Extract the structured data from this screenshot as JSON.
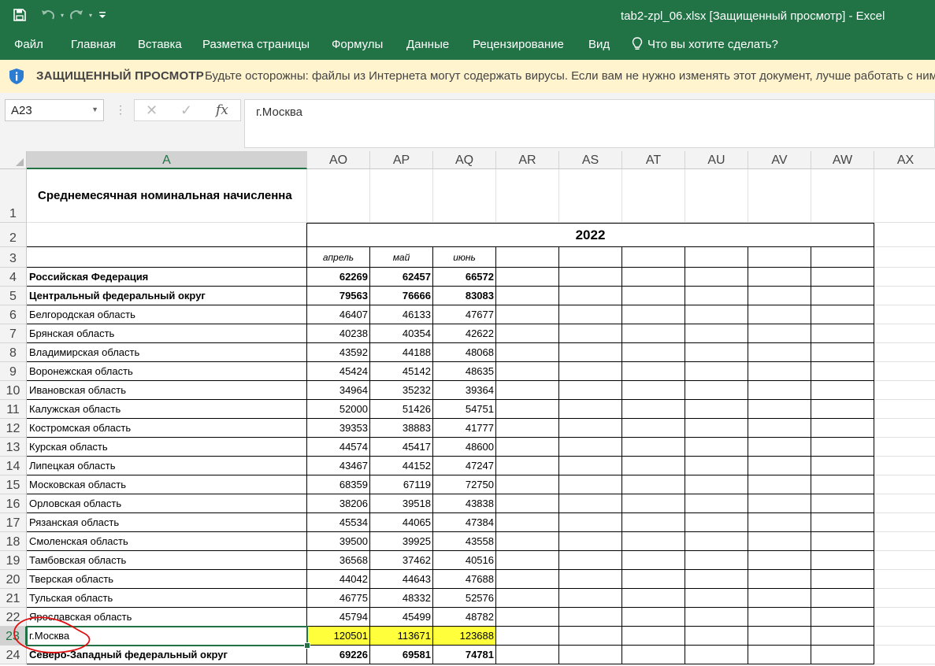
{
  "titlebar": {
    "title": "tab2-zpl_06.xlsx  [Защищенный просмотр] - Excel",
    "icons": [
      "save-icon",
      "undo-icon",
      "redo-icon",
      "customize-qat-icon"
    ]
  },
  "ribbon": {
    "tabs": [
      "Файл",
      "Главная",
      "Вставка",
      "Разметка страницы",
      "Формулы",
      "Данные",
      "Рецензирование",
      "Вид"
    ],
    "tell_me": "Что вы хотите сделать?"
  },
  "protected_view": {
    "title": "ЗАЩИЩЕННЫЙ ПРОСМОТР",
    "message": "Будьте осторожны: файлы из Интернета могут содержать вирусы. Если вам не нужно изменять этот документ, лучше работать с ним"
  },
  "formula_bar": {
    "name_box": "A23",
    "formula": "г.Москва"
  },
  "colors": {
    "accent": "#217346",
    "highlight": "#ffff3c",
    "annotation": "#e01010",
    "warning_bar": "#fff4ce"
  },
  "sheet": {
    "columns": [
      "A",
      "AO",
      "AP",
      "AQ",
      "AR",
      "AS",
      "AT",
      "AU",
      "AV",
      "AW",
      "AX"
    ],
    "row_numbers": [
      "1",
      "2",
      "3",
      "4",
      "5",
      "6",
      "7",
      "8",
      "9",
      "10",
      "11",
      "12",
      "13",
      "14",
      "15",
      "16",
      "17",
      "18",
      "19",
      "20",
      "21",
      "22",
      "23",
      "24"
    ],
    "title": "Среднемесячная номинальная начисленна",
    "year": "2022",
    "months": [
      "апрель",
      "май",
      "июнь"
    ],
    "rows": [
      {
        "name": "Российская Федерация",
        "values": [
          "62269",
          "62457",
          "66572"
        ]
      },
      {
        "name": "Центральный федеральный округ",
        "values": [
          "79563",
          "76666",
          "83083"
        ]
      },
      {
        "name": "Белгородская область",
        "values": [
          "46407",
          "46133",
          "47677"
        ]
      },
      {
        "name": "Брянская область",
        "values": [
          "40238",
          "40354",
          "42622"
        ]
      },
      {
        "name": "Владимирская область",
        "values": [
          "43592",
          "44188",
          "48068"
        ]
      },
      {
        "name": "Воронежская область",
        "values": [
          "45424",
          "45142",
          "48635"
        ]
      },
      {
        "name": "Ивановская область",
        "values": [
          "34964",
          "35232",
          "39364"
        ]
      },
      {
        "name": "Калужская область",
        "values": [
          "52000",
          "51426",
          "54751"
        ]
      },
      {
        "name": "Костромская область",
        "values": [
          "39353",
          "38883",
          "41777"
        ]
      },
      {
        "name": "Курская область",
        "values": [
          "44574",
          "45417",
          "48600"
        ]
      },
      {
        "name": "Липецкая область",
        "values": [
          "43467",
          "44152",
          "47247"
        ]
      },
      {
        "name": "Московская область",
        "values": [
          "68359",
          "67119",
          "72750"
        ]
      },
      {
        "name": "Орловская область",
        "values": [
          "38206",
          "39518",
          "43838"
        ]
      },
      {
        "name": "Рязанская область",
        "values": [
          "45534",
          "44065",
          "47384"
        ]
      },
      {
        "name": "Смоленская область",
        "values": [
          "39500",
          "39925",
          "43558"
        ]
      },
      {
        "name": "Тамбовская область",
        "values": [
          "36568",
          "37462",
          "40516"
        ]
      },
      {
        "name": "Тверская область",
        "values": [
          "44042",
          "44643",
          "47688"
        ]
      },
      {
        "name": "Тульская область",
        "values": [
          "46775",
          "48332",
          "52576"
        ]
      },
      {
        "name": "Ярославская область",
        "values": [
          "45794",
          "45499",
          "48782"
        ]
      },
      {
        "name": "г.Москва",
        "values": [
          "120501",
          "113671",
          "123688"
        ]
      },
      {
        "name": "Северо-Западный федеральный округ",
        "values": [
          "69226",
          "69581",
          "74781"
        ]
      }
    ]
  }
}
